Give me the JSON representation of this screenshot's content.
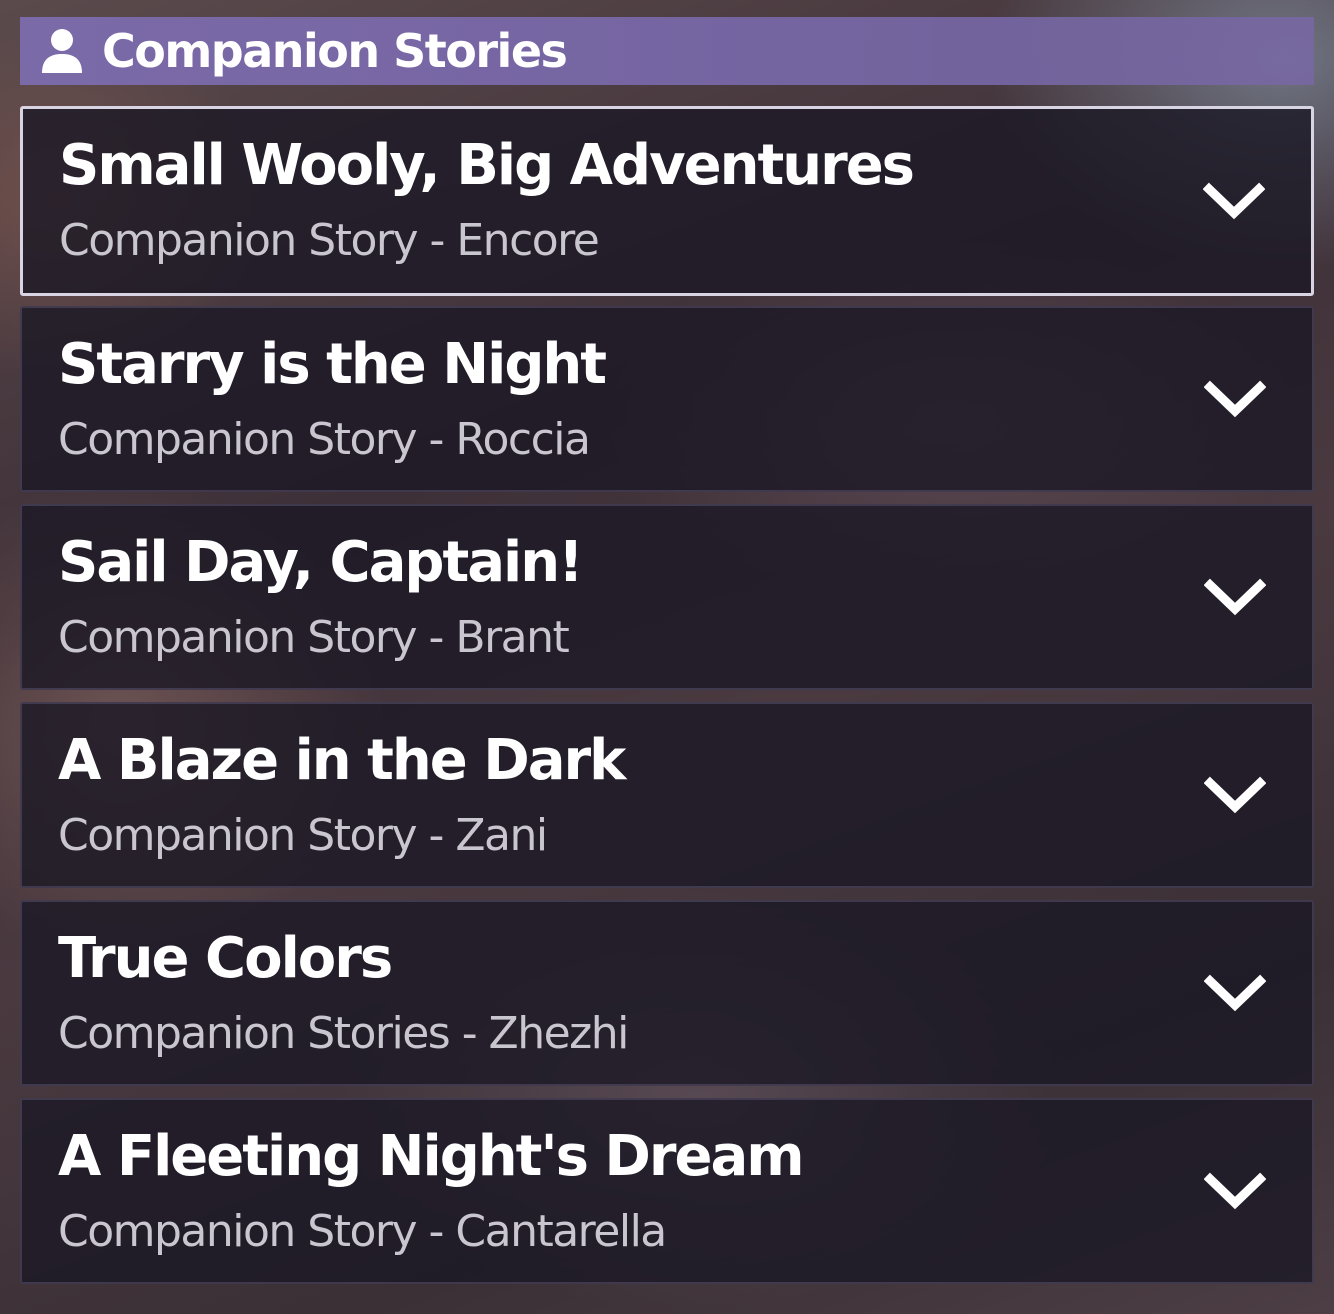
{
  "header": {
    "icon": "person-icon",
    "title": "Companion Stories"
  },
  "stories": [
    {
      "title": "Small Wooly, Big Adventures",
      "subtitle": "Companion Story - Encore",
      "selected": true,
      "icon": "chevron-down-icon"
    },
    {
      "title": "Starry is the Night",
      "subtitle": "Companion Story - Roccia",
      "selected": false,
      "icon": "chevron-down-icon"
    },
    {
      "title": "Sail Day, Captain!",
      "subtitle": "Companion Story - Brant",
      "selected": false,
      "icon": "chevron-down-icon"
    },
    {
      "title": "A Blaze in the Dark",
      "subtitle": "Companion Story - Zani",
      "selected": false,
      "icon": "chevron-down-icon"
    },
    {
      "title": "True Colors",
      "subtitle": "Companion Stories - Zhezhi",
      "selected": false,
      "icon": "chevron-down-icon"
    },
    {
      "title": "A Fleeting Night's Dream",
      "subtitle": "Companion Story - Cantarella",
      "selected": false,
      "icon": "chevron-down-icon"
    }
  ],
  "colors": {
    "header_bg": "#7b6aa8",
    "item_bg": "#1a1824",
    "title_text": "#ffffff",
    "subtitle_text": "#c9c6cf",
    "selected_border": "#d8d4e4"
  }
}
